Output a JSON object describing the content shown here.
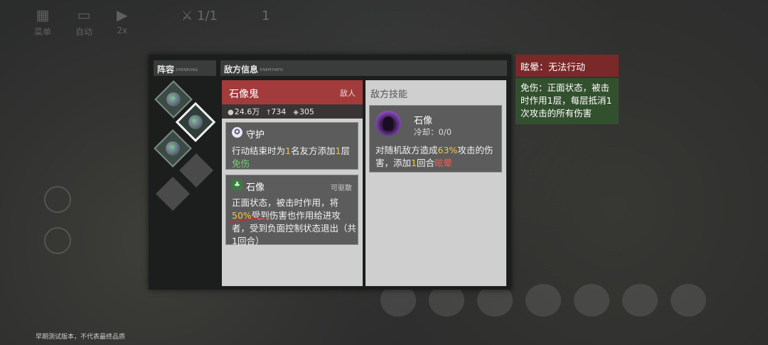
{
  "hud": {
    "menu_label": "菜单",
    "auto_label": "自动",
    "speed_label": "2x",
    "counter1": "1/1",
    "counter2": "1"
  },
  "lineup": {
    "title": "阵容",
    "subtitle": "ZHENRONG"
  },
  "enemy_info": {
    "title": "敌方信息",
    "subtitle": "ENEMYINFO"
  },
  "enemy": {
    "name": "石像鬼",
    "tag": "敌人",
    "hp": "24.6万",
    "atk": "734",
    "def": "305"
  },
  "buffs": [
    {
      "name": "守护",
      "icon": "shield-icon",
      "desc_parts": [
        "行动结束时为",
        "1",
        "名友方添加",
        "1",
        "层",
        "免伤"
      ]
    },
    {
      "name": "石像",
      "icon": "clover-icon",
      "tag": "可驱散",
      "desc_parts": [
        "正面状态，被击时作用，将",
        "50%",
        "受到伤害也作用给进攻者，受到负面控制状态退出（共1回合）"
      ]
    }
  ],
  "skills": {
    "title": "敌方技能",
    "skill_name": "石像",
    "cooldown": "冷却：0/0",
    "desc_parts": [
      "对随机敌方造成",
      "63%",
      "攻击的伤害，添加",
      "1",
      "回合",
      "眩晕"
    ]
  },
  "tooltip": {
    "title": "眩晕：无法行动",
    "body": "免伤：正面状态，被击时作用1层，每层抵消1次攻击的所有伤害"
  },
  "footer_note": "早期测试版本，不代表最终品质",
  "colors": {
    "enemy_title_bg": "#a23c3c",
    "highlight_yellow": "#f1c744",
    "highlight_green": "#74cf6e",
    "highlight_red": "#ef5b4f",
    "tooltip_red": "#7a2828",
    "tooltip_green": "#33502e"
  }
}
